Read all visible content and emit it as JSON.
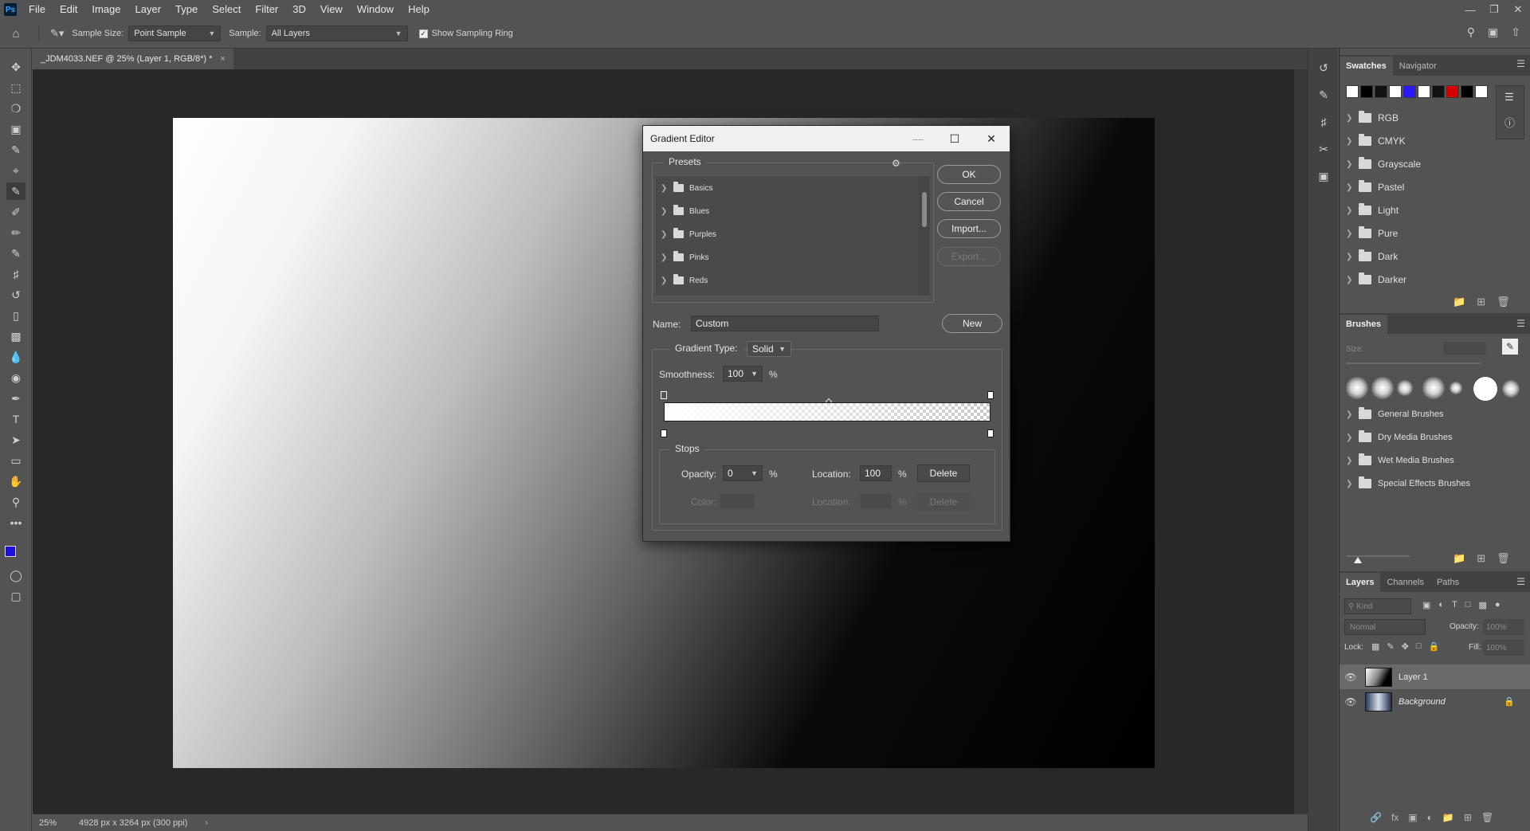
{
  "app": {
    "logo": "Ps"
  },
  "menu": [
    "File",
    "Edit",
    "Image",
    "Layer",
    "Type",
    "Select",
    "Filter",
    "3D",
    "View",
    "Window",
    "Help"
  ],
  "options_bar": {
    "sample_size_label": "Sample Size:",
    "sample_size_value": "Point Sample",
    "sample_label": "Sample:",
    "sample_value": "All Layers",
    "show_sampling_ring_label": "Show Sampling Ring",
    "show_sampling_ring_checked": true
  },
  "document": {
    "tab_title": "_JDM4033.NEF @ 25% (Layer 1, RGB/8*) *",
    "zoom": "25%",
    "size_info": "4928 px x 3264 px (300 ppi)"
  },
  "colors": {
    "foreground": "#1a10e0",
    "background": "#ffffff",
    "accent_red": "#d40000",
    "panel_bg": "#535353"
  },
  "swatches_panel": {
    "tabs": [
      "Swatches",
      "Navigator"
    ],
    "swatch_colors": [
      "#ffffff",
      "#000000",
      "#111111",
      "#ffffff",
      "#2c1aff",
      "#ffffff",
      "#111111",
      "#d40000",
      "#000000",
      "#ffffff"
    ],
    "groups": [
      "RGB",
      "CMYK",
      "Grayscale",
      "Pastel",
      "Light",
      "Pure",
      "Dark",
      "Darker"
    ]
  },
  "brushes_panel": {
    "tab": "Brushes",
    "size_label": "Size:",
    "groups": [
      "General Brushes",
      "Dry Media Brushes",
      "Wet Media Brushes",
      "Special Effects Brushes"
    ]
  },
  "layers_panel": {
    "tabs": [
      "Layers",
      "Channels",
      "Paths"
    ],
    "kind_placeholder": "Kind",
    "blend_mode": "Normal",
    "opacity_label": "Opacity:",
    "opacity_value": "100%",
    "lock_label": "Lock:",
    "fill_label": "Fill:",
    "fill_value": "100%",
    "layers": [
      {
        "name": "Layer 1",
        "visible": true,
        "selected": true
      },
      {
        "name": "Background",
        "visible": true,
        "locked": true
      }
    ]
  },
  "gradient_editor": {
    "title": "Gradient Editor",
    "presets_label": "Presets",
    "preset_folders": [
      "Basics",
      "Blues",
      "Purples",
      "Pinks",
      "Reds"
    ],
    "buttons": {
      "ok": "OK",
      "cancel": "Cancel",
      "import": "Import...",
      "export": "Export...",
      "new": "New"
    },
    "name_label": "Name:",
    "name_value": "Custom",
    "gradient_type_label": "Gradient Type:",
    "gradient_type_value": "Solid",
    "smoothness_label": "Smoothness:",
    "smoothness_value": "100",
    "percent": "%",
    "stops": {
      "legend": "Stops",
      "opacity_label": "Opacity:",
      "opacity_value": "0",
      "location_label": "Location:",
      "location_value": "100",
      "delete_label": "Delete",
      "color_label": "Color:",
      "color_location_label": "Location:",
      "color_delete_label": "Delete"
    }
  }
}
